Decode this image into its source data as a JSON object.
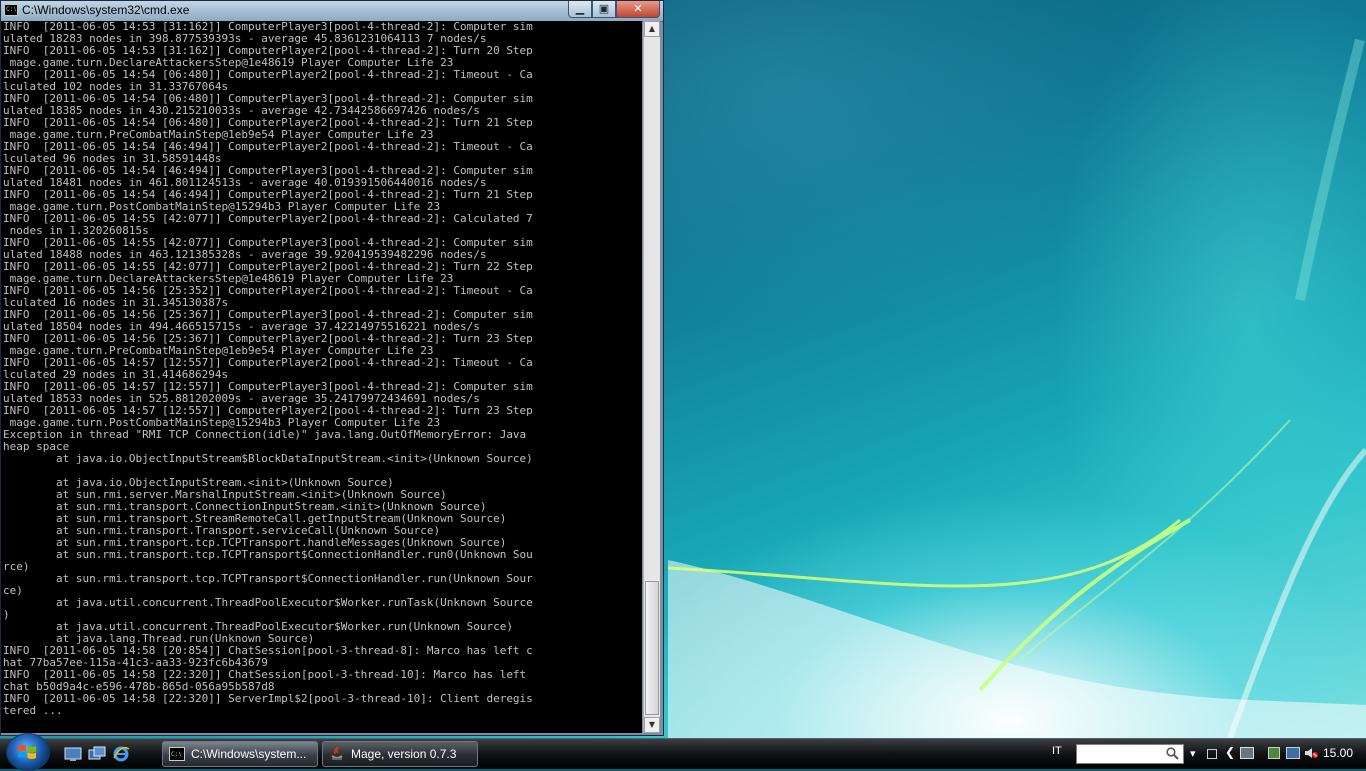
{
  "window": {
    "title": "C:\\Windows\\system32\\cmd.exe",
    "minimize_label": "▁",
    "maximize_label": "▣",
    "close_label": "✕"
  },
  "console": {
    "lines": [
      "INFO  [2011-06-05 14:53 [31:162]] ComputerPlayer3[pool-4-thread-2]: Computer sim",
      "ulated 18283 nodes in 398.877539393s - average 45.8361231064113 7 nodes/s",
      "INFO  [2011-06-05 14:53 [31:162]] ComputerPlayer2[pool-4-thread-2]: Turn 20 Step",
      " mage.game.turn.DeclareAttackersStep@1e48619 Player Computer Life 23",
      "INFO  [2011-06-05 14:54 [06:480]] ComputerPlayer2[pool-4-thread-2]: Timeout - Ca",
      "lculated 102 nodes in 31.33767064s",
      "INFO  [2011-06-05 14:54 [06:480]] ComputerPlayer3[pool-4-thread-2]: Computer sim",
      "ulated 18385 nodes in 430.215210033s - average 42.73442586697426 nodes/s",
      "INFO  [2011-06-05 14:54 [06:480]] ComputerPlayer2[pool-4-thread-2]: Turn 21 Step",
      " mage.game.turn.PreCombatMainStep@1eb9e54 Player Computer Life 23",
      "INFO  [2011-06-05 14:54 [46:494]] ComputerPlayer2[pool-4-thread-2]: Timeout - Ca",
      "lculated 96 nodes in 31.58591448s",
      "INFO  [2011-06-05 14:54 [46:494]] ComputerPlayer3[pool-4-thread-2]: Computer sim",
      "ulated 18481 nodes in 461.801124513s - average 40.019391506440016 nodes/s",
      "INFO  [2011-06-05 14:54 [46:494]] ComputerPlayer2[pool-4-thread-2]: Turn 21 Step",
      " mage.game.turn.PostCombatMainStep@15294b3 Player Computer Life 23",
      "INFO  [2011-06-05 14:55 [42:077]] ComputerPlayer2[pool-4-thread-2]: Calculated 7",
      " nodes in 1.320260815s",
      "INFO  [2011-06-05 14:55 [42:077]] ComputerPlayer3[pool-4-thread-2]: Computer sim",
      "ulated 18488 nodes in 463.121385328s - average 39.920419539482296 nodes/s",
      "INFO  [2011-06-05 14:55 [42:077]] ComputerPlayer2[pool-4-thread-2]: Turn 22 Step",
      " mage.game.turn.DeclareAttackersStep@1e48619 Player Computer Life 23",
      "INFO  [2011-06-05 14:56 [25:352]] ComputerPlayer2[pool-4-thread-2]: Timeout - Ca",
      "lculated 16 nodes in 31.345130387s",
      "INFO  [2011-06-05 14:56 [25:367]] ComputerPlayer3[pool-4-thread-2]: Computer sim",
      "ulated 18504 nodes in 494.466515715s - average 37.42214975516221 nodes/s",
      "INFO  [2011-06-05 14:56 [25:367]] ComputerPlayer2[pool-4-thread-2]: Turn 23 Step",
      " mage.game.turn.PreCombatMainStep@1eb9e54 Player Computer Life 23",
      "INFO  [2011-06-05 14:57 [12:557]] ComputerPlayer2[pool-4-thread-2]: Timeout - Ca",
      "lculated 29 nodes in 31.414686294s",
      "INFO  [2011-06-05 14:57 [12:557]] ComputerPlayer3[pool-4-thread-2]: Computer sim",
      "ulated 18533 nodes in 525.881202009s - average 35.24179972434691 nodes/s",
      "INFO  [2011-06-05 14:57 [12:557]] ComputerPlayer2[pool-4-thread-2]: Turn 23 Step",
      " mage.game.turn.PostCombatMainStep@15294b3 Player Computer Life 23",
      "Exception in thread \"RMI TCP Connection(idle)\" java.lang.OutOfMemoryError: Java",
      "heap space",
      "        at java.io.ObjectInputStream$BlockDataInputStream.<init>(Unknown Source)",
      "",
      "        at java.io.ObjectInputStream.<init>(Unknown Source)",
      "        at sun.rmi.server.MarshalInputStream.<init>(Unknown Source)",
      "        at sun.rmi.transport.ConnectionInputStream.<init>(Unknown Source)",
      "        at sun.rmi.transport.StreamRemoteCall.getInputStream(Unknown Source)",
      "        at sun.rmi.transport.Transport.serviceCall(Unknown Source)",
      "        at sun.rmi.transport.tcp.TCPTransport.handleMessages(Unknown Source)",
      "        at sun.rmi.transport.tcp.TCPTransport$ConnectionHandler.run0(Unknown Sou",
      "rce)",
      "        at sun.rmi.transport.tcp.TCPTransport$ConnectionHandler.run(Unknown Sour",
      "ce)",
      "        at java.util.concurrent.ThreadPoolExecutor$Worker.runTask(Unknown Source",
      ")",
      "        at java.util.concurrent.ThreadPoolExecutor$Worker.run(Unknown Source)",
      "        at java.lang.Thread.run(Unknown Source)",
      "INFO  [2011-06-05 14:58 [20:854]] ChatSession[pool-3-thread-8]: Marco has left c",
      "hat 77ba57ee-115a-41c3-aa33-923fc6b43679",
      "INFO  [2011-06-05 14:58 [22:320]] ChatSession[pool-3-thread-10]: Marco has left",
      "chat b50d9a4c-e596-478b-865d-056a95b587d8",
      "INFO  [2011-06-05 14:58 [22:320]] ServerImpl$2[pool-3-thread-10]: Client deregis",
      "tered ..."
    ]
  },
  "taskbar": {
    "tasks": [
      {
        "label": "C:\\Windows\\system...",
        "icon": "cmd-icon"
      },
      {
        "label": "Mage, version 0.7.3",
        "icon": "java-icon"
      }
    ],
    "language": "IT",
    "search_placeholder": "",
    "clock": "15.00",
    "tray_arrow": "❮"
  },
  "colors": {
    "console_bg": "#000000",
    "console_fg": "#c0c0c0",
    "close_button": "#c0452f"
  }
}
